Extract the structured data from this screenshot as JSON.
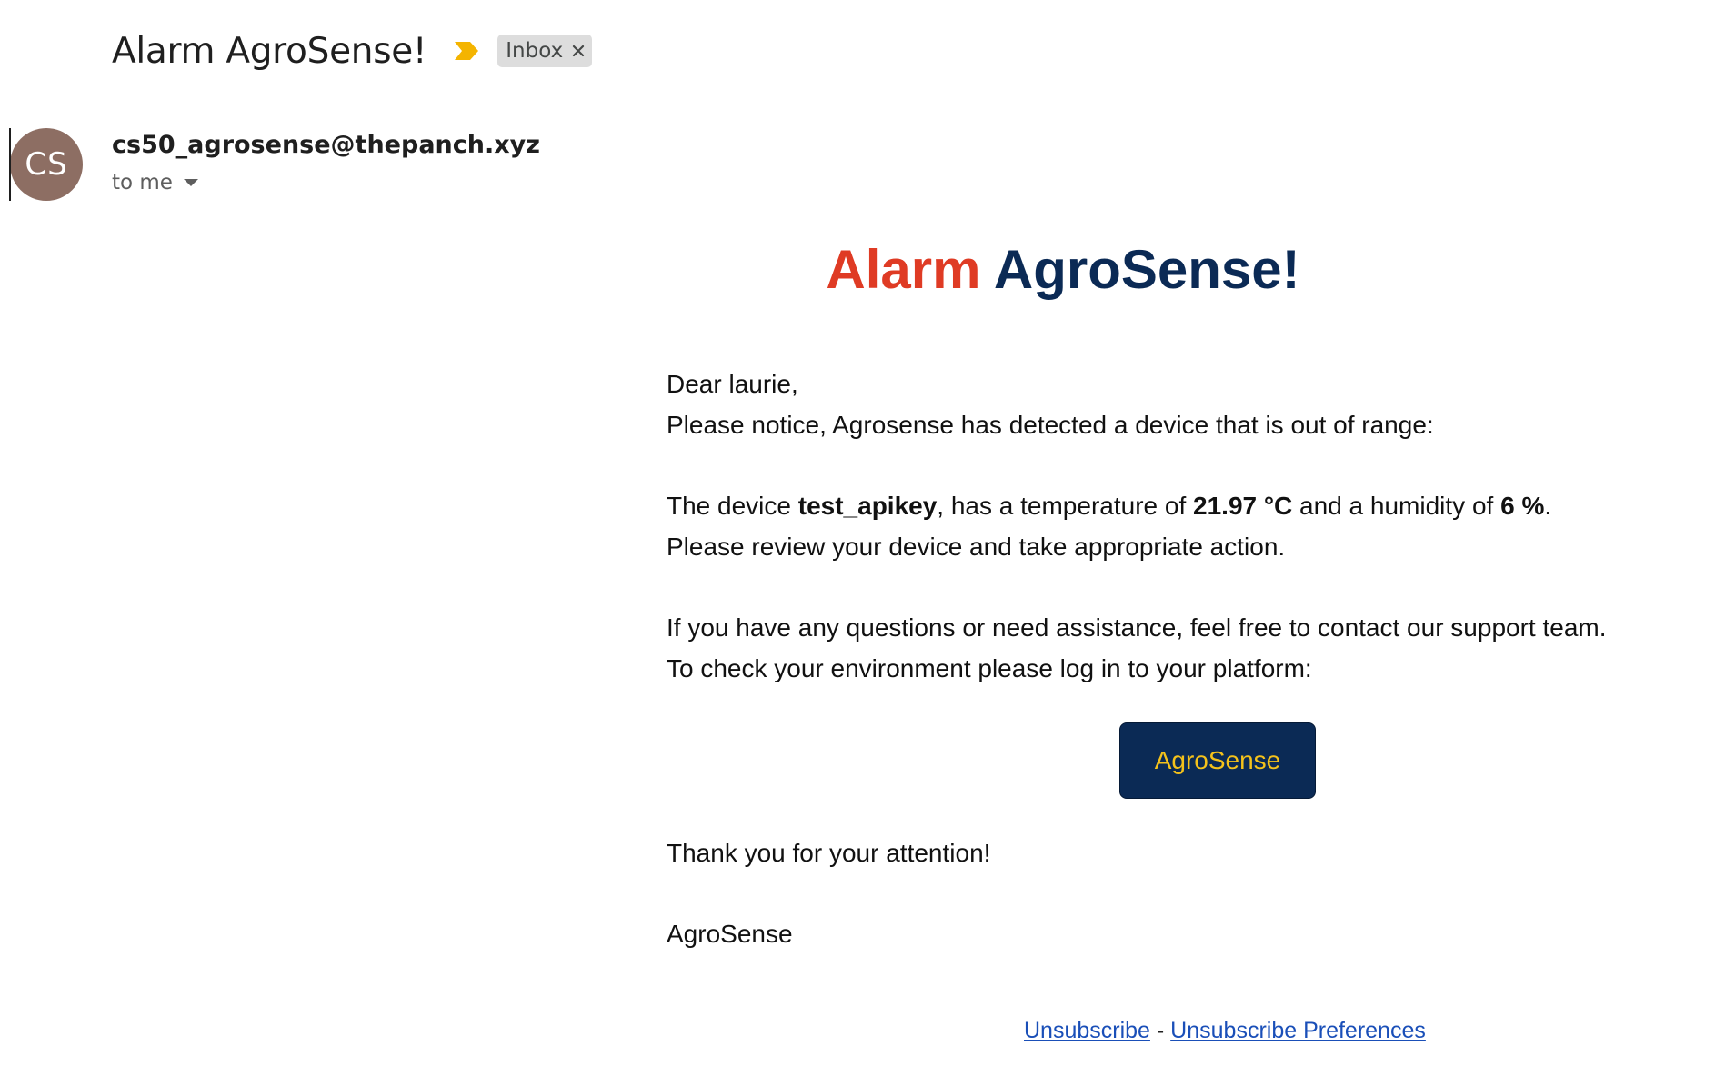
{
  "header": {
    "subject": "Alarm AgroSense!",
    "importance_icon": "importance-marker-icon",
    "label": "Inbox"
  },
  "message": {
    "avatar_initials": "CS",
    "avatar_color": "#8d6e63",
    "sender": "cs50_agrosense@thepanch.xyz",
    "recipient": "to me"
  },
  "email": {
    "title_part1": "Alarm",
    "title_part2": "AgroSense!",
    "greeting": "Dear laurie,",
    "notice": "Please notice, Agrosense has detected a device that is out of range:",
    "device_prefix": "The device ",
    "device_name": "test_apikey",
    "temp_prefix": ", has a temperature of ",
    "temperature": "21.97 °C",
    "humidity_prefix": " and a humidity of ",
    "humidity": "6 %",
    "humidity_suffix": ".",
    "review": "Please review your device and take appropriate action.",
    "questions": "If you have any questions or need assistance, feel free to contact our support team.",
    "login_prompt": "To check your environment please log in to your platform:",
    "button_label": "AgroSense",
    "thanks": "Thank you for your attention!",
    "signature": "AgroSense",
    "unsubscribe": "Unsubscribe",
    "separator": " - ",
    "unsubscribe_prefs": "Unsubscribe Preferences"
  },
  "colors": {
    "alarm_red": "#df3b24",
    "brand_navy": "#0b2a55",
    "button_text_yellow": "#f5c21b",
    "importance_yellow": "#f4b400",
    "link_blue": "#1a4fb8"
  }
}
